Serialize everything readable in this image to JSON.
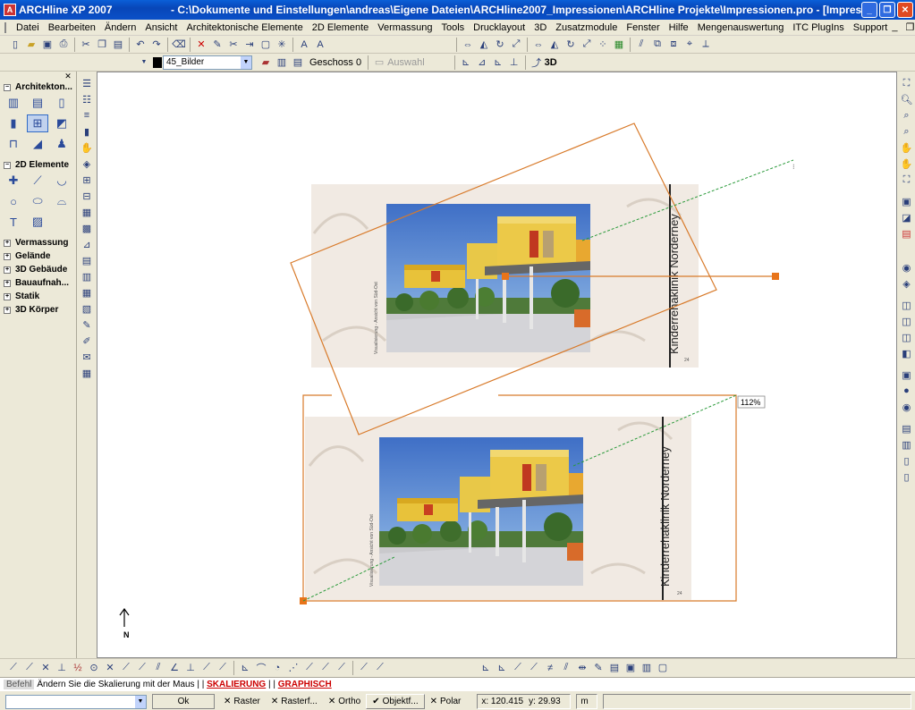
{
  "window": {
    "app_title": "ARCHline XP 2007",
    "path_title": "- C:\\Dokumente und Einstellungen\\andreas\\Eigene Dateien\\ARCHline2007_Impressionen\\ARCHline Projekte\\Impressionen.pro - [Impressi]"
  },
  "menu": [
    "Datei",
    "Bearbeiten",
    "Ändern",
    "Ansicht",
    "Architektonische Elemente",
    "2D Elemente",
    "Vermassung",
    "Tools",
    "Drucklayout",
    "3D",
    "Zusatzmodule",
    "Fenster",
    "Hilfe",
    "Mengenauswertung",
    "ITC PlugIns",
    "Support"
  ],
  "toolbar2": {
    "layer": "45_Bilder",
    "storey": "Geschoss 0",
    "selection": "Auswahl",
    "view3d": "3D"
  },
  "left_panel": {
    "categories": {
      "architektur": "Architekton...",
      "elemente2d": "2D Elemente",
      "vermassung": "Vermassung",
      "gelaende": "Gelände",
      "gebaeude3d": "3D Gebäude",
      "bauaufnahme": "Bauaufnah...",
      "statik": "Statik",
      "koerper3d": "3D Körper"
    },
    "icons_arch": [
      "wall-icon",
      "window-icon",
      "door-icon",
      "column-icon",
      "grid-window-icon",
      "slab-icon",
      "beam-icon",
      "roof-icon",
      "furniture-icon"
    ],
    "icons_2d": [
      "point-icon",
      "line-icon",
      "arc-icon",
      "circle-icon",
      "ellipse-icon",
      "polyline-icon",
      "text-icon",
      "hatch-icon"
    ]
  },
  "drawing": {
    "sheet_vertical_text": "Kinderrehaklinik Norderney",
    "sheet_small_text": "Visualisierung  -  Ansicht von Süd-Ost",
    "page_number": "24",
    "scale_label": "112%",
    "north_label": "N",
    "colors": {
      "accent_orange": "#d87a2a",
      "guide_green": "#2a9a3a",
      "sheet_bg": "#f1eae3"
    }
  },
  "command": {
    "label": "Befehl",
    "prompt": "Ändern Sie die Skalierung mit der Maus",
    "keyword1": "SKALIERUNG",
    "separator": " | | ",
    "keyword2": "GRAPHISCH"
  },
  "status": {
    "ok": "Ok",
    "raster": "Raster",
    "rasterfang": "Rasterf...",
    "ortho": "Ortho",
    "objektfang": "Objektf...",
    "polar": "Polar",
    "x": "x: 120.415",
    "y": "y: 29.93",
    "unit": "m"
  }
}
